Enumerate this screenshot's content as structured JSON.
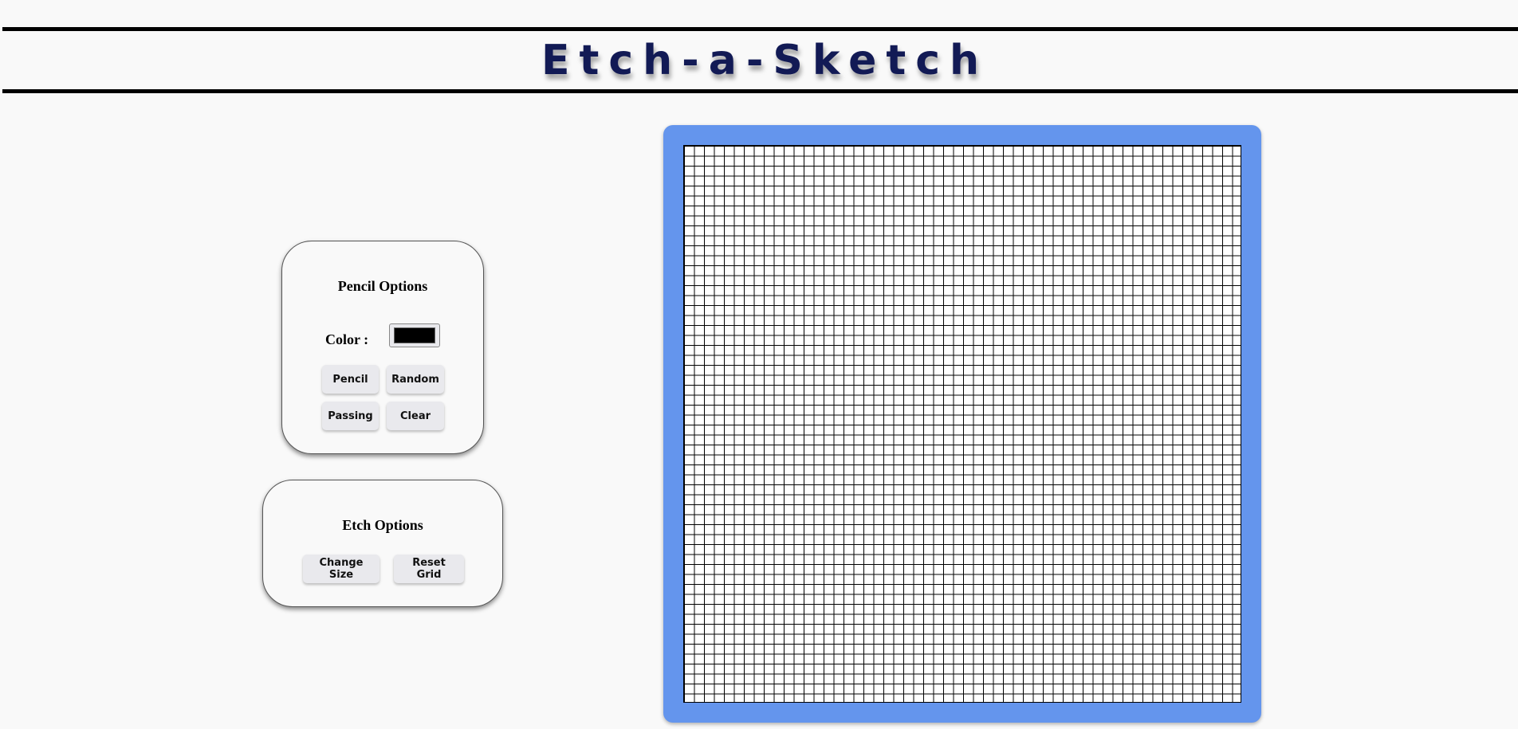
{
  "header": {
    "title": "Etch-a-Sketch"
  },
  "pencil_options": {
    "title": "Pencil Options",
    "color_label": "Color :",
    "color_value": "#000000",
    "buttons": {
      "pencil": "Pencil",
      "random": "Random",
      "passing": "Passing",
      "clear": "Clear"
    }
  },
  "etch_options": {
    "title": "Etch Options",
    "buttons": {
      "change_size": "Change Size",
      "reset_grid": "Reset Grid"
    }
  },
  "sketch_board": {
    "grid_size": 56,
    "cell_color": "#ffffff",
    "frame_color": "#6495ed"
  }
}
